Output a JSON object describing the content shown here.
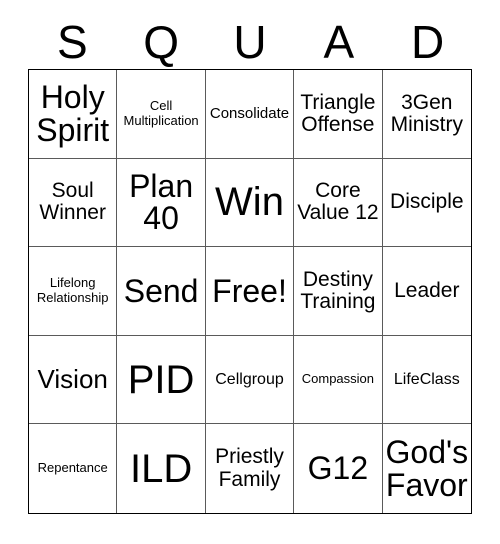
{
  "card": {
    "title_letters": [
      "S",
      "Q",
      "U",
      "A",
      "D"
    ],
    "columns": 5,
    "rows": 5,
    "colors": {
      "background": "#ffffff",
      "text": "#000000",
      "grid_line": "#5a5a5a",
      "outer_border": "#000000"
    }
  },
  "grid": {
    "cells": [
      {
        "text": "Holy Spirit",
        "size": "xl"
      },
      {
        "text": "Cell Multiplication",
        "size": "xs"
      },
      {
        "text": "Consolidate",
        "size": "sm"
      },
      {
        "text": "Triangle Offense",
        "size": "md"
      },
      {
        "text": "3Gen Ministry",
        "size": "md"
      },
      {
        "text": "Soul Winner",
        "size": "md"
      },
      {
        "text": "Plan 40",
        "size": "xl"
      },
      {
        "text": "Win",
        "size": "xxl"
      },
      {
        "text": "Core Value 12",
        "size": "md"
      },
      {
        "text": "Disciple",
        "size": "md"
      },
      {
        "text": "Lifelong Relationship",
        "size": "xs"
      },
      {
        "text": "Send",
        "size": "xl"
      },
      {
        "text": "Free!",
        "size": "xl"
      },
      {
        "text": "Destiny Training",
        "size": "md"
      },
      {
        "text": "Leader",
        "size": "md"
      },
      {
        "text": "Vision",
        "size": "lg"
      },
      {
        "text": "PID",
        "size": "xxl"
      },
      {
        "text": "Cellgroup",
        "size": "sm"
      },
      {
        "text": "Compassion",
        "size": "xs"
      },
      {
        "text": "LifeClass",
        "size": "sm"
      },
      {
        "text": "Repentance",
        "size": "xs"
      },
      {
        "text": "ILD",
        "size": "xxl"
      },
      {
        "text": "Priestly Family",
        "size": "md"
      },
      {
        "text": "G12",
        "size": "xl"
      },
      {
        "text": "God's Favor",
        "size": "xl"
      }
    ]
  }
}
